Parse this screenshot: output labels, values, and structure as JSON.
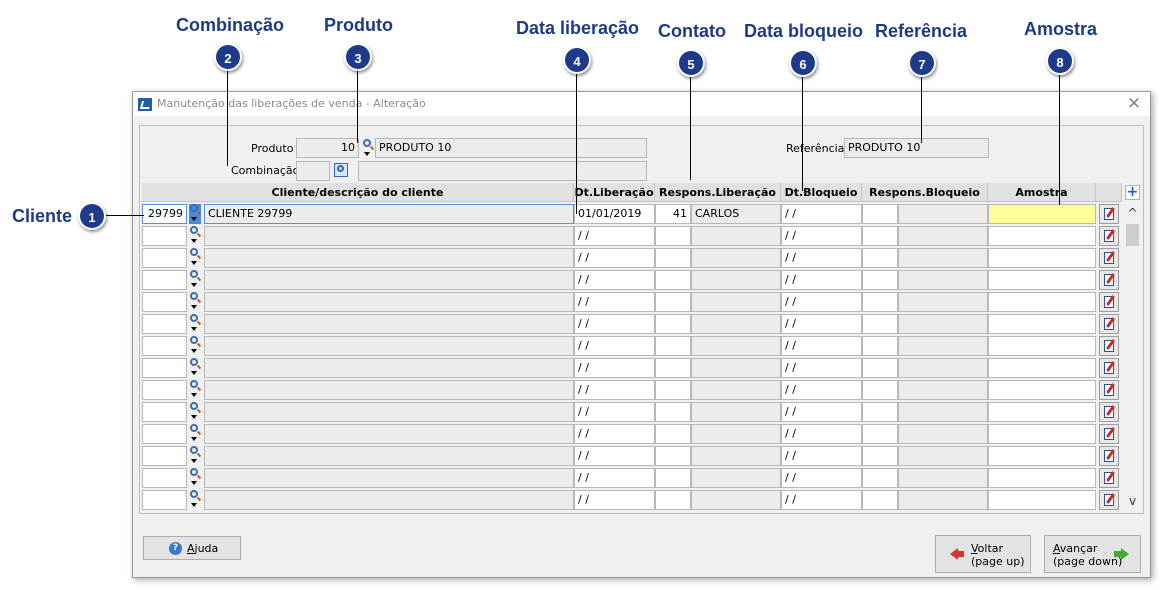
{
  "callouts": {
    "combinacao": "Combinação",
    "produto": "Produto",
    "data_liberacao": "Data liberação",
    "contato": "Contato",
    "data_bloqueio": "Data bloqueio",
    "referencia": "Referência",
    "amostra": "Amostra",
    "cliente": "Cliente"
  },
  "badges": [
    "1",
    "2",
    "3",
    "4",
    "5",
    "6",
    "7",
    "8"
  ],
  "window": {
    "title": "Manutenção das liberações de venda - Alteração",
    "close": "✕"
  },
  "form": {
    "produto_label": "Produto",
    "produto_code": "10",
    "produto_desc": "PRODUTO 10",
    "combinacao_label": "Combinação",
    "combinacao_code": "",
    "combinacao_desc": "",
    "referencia_label": "Referência",
    "referencia_value": "PRODUTO 10"
  },
  "grid": {
    "columns": [
      "Cliente/descrição do cliente",
      "Dt.Liberação",
      "Respons.Liberação",
      "Dt.Bloqueio",
      "Respons.Bloqueio",
      "Amostra"
    ],
    "add_button": "+",
    "rows": [
      {
        "cliente_code": "29799",
        "cliente_desc": "CLIENTE 29799",
        "dt_liberacao": "01/01/2019",
        "resp_lib_code": "41",
        "resp_lib_name": "CARLOS",
        "dt_bloqueio": "/ /",
        "resp_bloq_code": "",
        "resp_bloq_name": "",
        "amostra": ""
      },
      {
        "cliente_code": "",
        "cliente_desc": "",
        "dt_liberacao": "/ /",
        "resp_lib_code": "",
        "resp_lib_name": "",
        "dt_bloqueio": "/ /",
        "resp_bloq_code": "",
        "resp_bloq_name": "",
        "amostra": ""
      },
      {
        "cliente_code": "",
        "cliente_desc": "",
        "dt_liberacao": "/ /",
        "resp_lib_code": "",
        "resp_lib_name": "",
        "dt_bloqueio": "/ /",
        "resp_bloq_code": "",
        "resp_bloq_name": "",
        "amostra": ""
      },
      {
        "cliente_code": "",
        "cliente_desc": "",
        "dt_liberacao": "/ /",
        "resp_lib_code": "",
        "resp_lib_name": "",
        "dt_bloqueio": "/ /",
        "resp_bloq_code": "",
        "resp_bloq_name": "",
        "amostra": ""
      },
      {
        "cliente_code": "",
        "cliente_desc": "",
        "dt_liberacao": "/ /",
        "resp_lib_code": "",
        "resp_lib_name": "",
        "dt_bloqueio": "/ /",
        "resp_bloq_code": "",
        "resp_bloq_name": "",
        "amostra": ""
      },
      {
        "cliente_code": "",
        "cliente_desc": "",
        "dt_liberacao": "/ /",
        "resp_lib_code": "",
        "resp_lib_name": "",
        "dt_bloqueio": "/ /",
        "resp_bloq_code": "",
        "resp_bloq_name": "",
        "amostra": ""
      },
      {
        "cliente_code": "",
        "cliente_desc": "",
        "dt_liberacao": "/ /",
        "resp_lib_code": "",
        "resp_lib_name": "",
        "dt_bloqueio": "/ /",
        "resp_bloq_code": "",
        "resp_bloq_name": "",
        "amostra": ""
      },
      {
        "cliente_code": "",
        "cliente_desc": "",
        "dt_liberacao": "/ /",
        "resp_lib_code": "",
        "resp_lib_name": "",
        "dt_bloqueio": "/ /",
        "resp_bloq_code": "",
        "resp_bloq_name": "",
        "amostra": ""
      },
      {
        "cliente_code": "",
        "cliente_desc": "",
        "dt_liberacao": "/ /",
        "resp_lib_code": "",
        "resp_lib_name": "",
        "dt_bloqueio": "/ /",
        "resp_bloq_code": "",
        "resp_bloq_name": "",
        "amostra": ""
      },
      {
        "cliente_code": "",
        "cliente_desc": "",
        "dt_liberacao": "/ /",
        "resp_lib_code": "",
        "resp_lib_name": "",
        "dt_bloqueio": "/ /",
        "resp_bloq_code": "",
        "resp_bloq_name": "",
        "amostra": ""
      },
      {
        "cliente_code": "",
        "cliente_desc": "",
        "dt_liberacao": "/ /",
        "resp_lib_code": "",
        "resp_lib_name": "",
        "dt_bloqueio": "/ /",
        "resp_bloq_code": "",
        "resp_bloq_name": "",
        "amostra": ""
      },
      {
        "cliente_code": "",
        "cliente_desc": "",
        "dt_liberacao": "/ /",
        "resp_lib_code": "",
        "resp_lib_name": "",
        "dt_bloqueio": "/ /",
        "resp_bloq_code": "",
        "resp_bloq_name": "",
        "amostra": ""
      },
      {
        "cliente_code": "",
        "cliente_desc": "",
        "dt_liberacao": "/ /",
        "resp_lib_code": "",
        "resp_lib_name": "",
        "dt_bloqueio": "/ /",
        "resp_bloq_code": "",
        "resp_bloq_name": "",
        "amostra": ""
      },
      {
        "cliente_code": "",
        "cliente_desc": "",
        "dt_liberacao": "/ /",
        "resp_lib_code": "",
        "resp_lib_name": "",
        "dt_bloqueio": "/ /",
        "resp_bloq_code": "",
        "resp_bloq_name": "",
        "amostra": ""
      }
    ]
  },
  "buttons": {
    "ajuda_access": "A",
    "ajuda_rest": "juda",
    "voltar_access": "V",
    "voltar_rest": "oltar",
    "voltar_sub": "(page up)",
    "avancar_access": "A",
    "avancar_rest": "vançar",
    "avancar_sub": "(page down)"
  },
  "icons": {
    "lookup": "magnifier-icon",
    "edit": "edit-note-icon",
    "help": "help-icon",
    "back": "red-left-arrow-icon",
    "forward": "green-right-arrow-icon",
    "scroll_up": "^",
    "scroll_down": "v"
  },
  "colors": {
    "callout_text": "#1d3b82",
    "badge_fill": "#1e3a8a",
    "amostra_active": "#ffff99",
    "window_bg": "#f0f0f0"
  }
}
